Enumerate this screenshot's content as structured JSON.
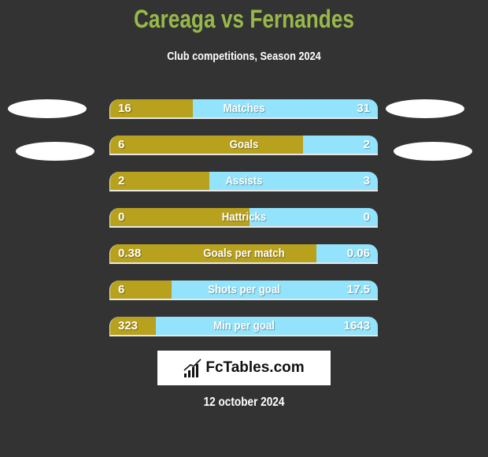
{
  "header": {
    "title": "Careaga vs Fernandes",
    "subtitle": "Club competitions, Season 2024"
  },
  "colors": {
    "left_player": "#b8a11c",
    "right_player": "#92e3fb",
    "title": "#98b84a",
    "background": "#333333"
  },
  "stats": [
    {
      "label": "Matches",
      "left": "16",
      "right": "31",
      "left_fraction": 0.31
    },
    {
      "label": "Goals",
      "left": "6",
      "right": "2",
      "left_fraction": 0.72
    },
    {
      "label": "Assists",
      "left": "2",
      "right": "3",
      "left_fraction": 0.37
    },
    {
      "label": "Hattricks",
      "left": "0",
      "right": "0",
      "left_fraction": 0.52
    },
    {
      "label": "Goals per match",
      "left": "0.38",
      "right": "0.06",
      "left_fraction": 0.77
    },
    {
      "label": "Shots per goal",
      "left": "6",
      "right": "17.5",
      "left_fraction": 0.23
    },
    {
      "label": "Min per goal",
      "left": "323",
      "right": "1643",
      "left_fraction": 0.17
    }
  ],
  "logo": {
    "text": "FcTables.com",
    "icon": "bar-chart-trend-icon"
  },
  "footer": {
    "date": "12 october 2024"
  }
}
